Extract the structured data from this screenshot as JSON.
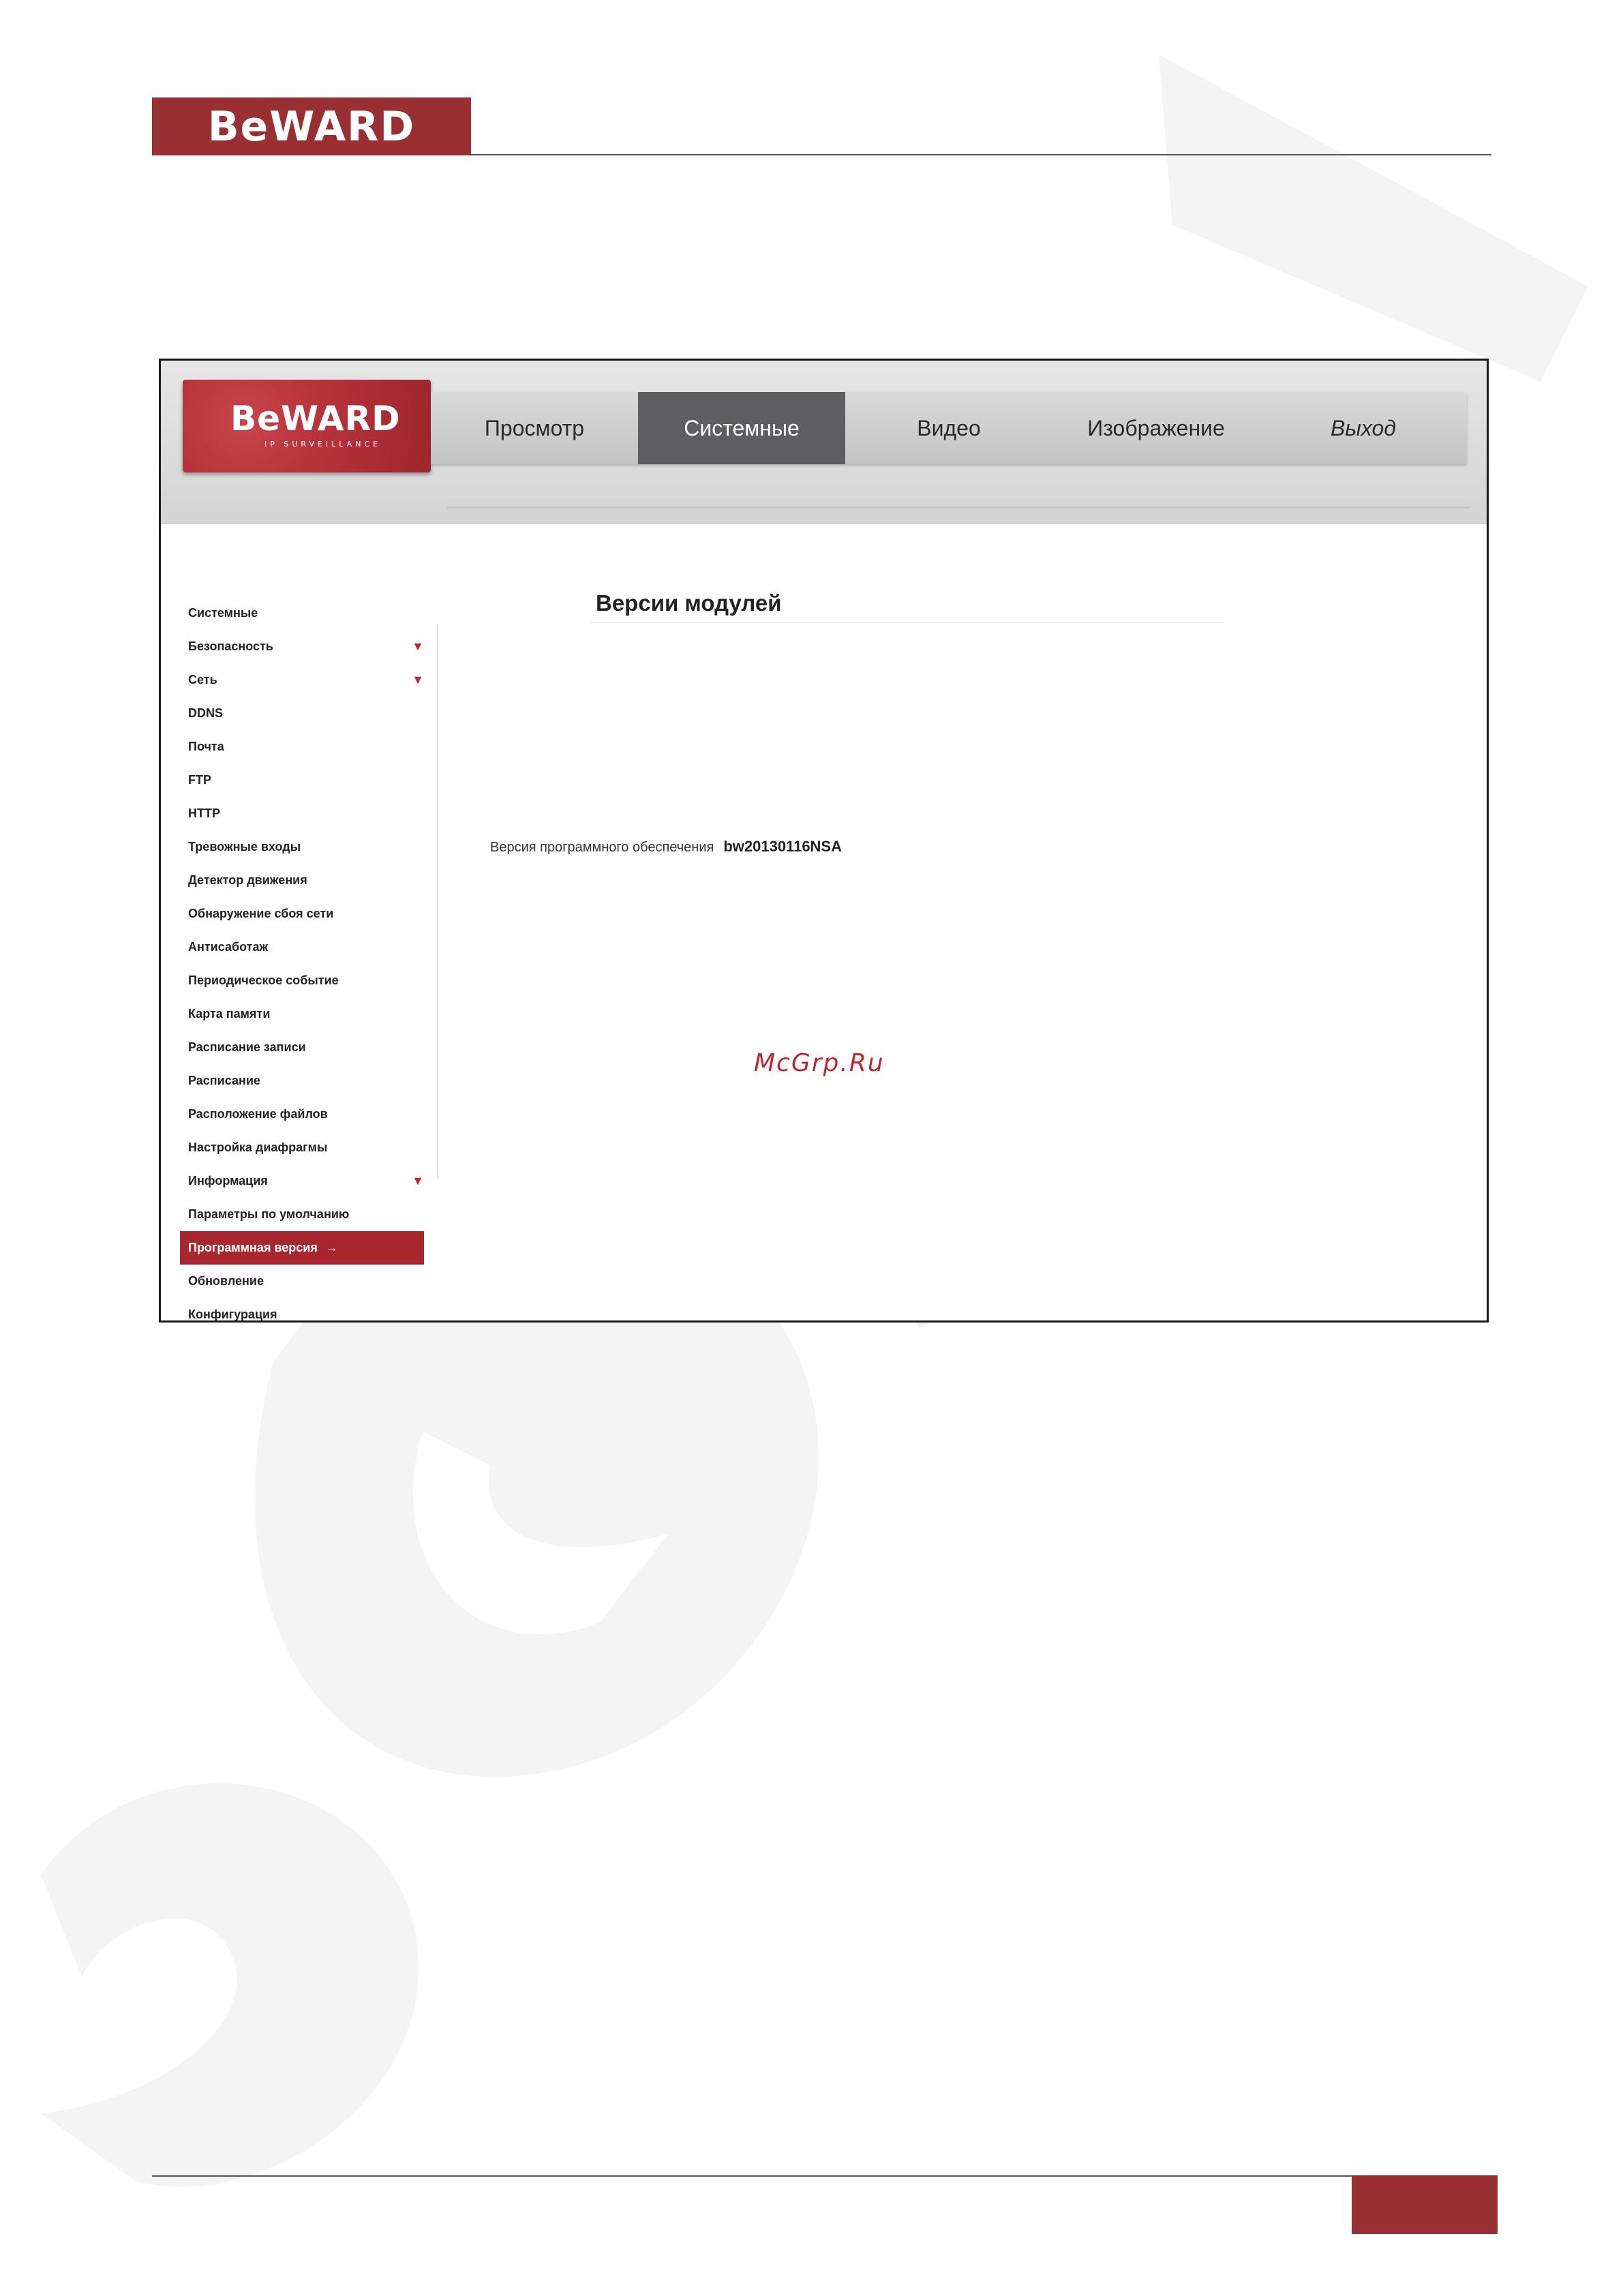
{
  "page": {
    "logo_text": "BeWARD"
  },
  "app": {
    "logo": {
      "brand": "BeWARD",
      "tagline": "IP SURVEILLANCE"
    },
    "nav": [
      {
        "label": "Просмотр",
        "active": false
      },
      {
        "label": "Системные",
        "active": true
      },
      {
        "label": "Видео",
        "active": false
      },
      {
        "label": "Изображение",
        "active": false
      },
      {
        "label": "Выход",
        "active": false
      }
    ],
    "sidebar": [
      {
        "label": "Системные"
      },
      {
        "label": "Безопасность",
        "expandable": true
      },
      {
        "label": "Сеть",
        "expandable": true
      },
      {
        "label": "DDNS"
      },
      {
        "label": "Почта"
      },
      {
        "label": "FTP"
      },
      {
        "label": "HTTP"
      },
      {
        "label": "Тревожные входы"
      },
      {
        "label": "Детектор движения"
      },
      {
        "label": "Обнаружение сбоя сети"
      },
      {
        "label": "Антисаботаж"
      },
      {
        "label": "Периодическое событие"
      },
      {
        "label": "Карта памяти"
      },
      {
        "label": "Расписание записи"
      },
      {
        "label": "Расписание"
      },
      {
        "label": "Расположение файлов"
      },
      {
        "label": "Настройка диафрагмы"
      },
      {
        "label": "Информация",
        "expandable": true
      },
      {
        "label": "Параметры по умолчанию"
      },
      {
        "label": "Программная версия",
        "active": true
      },
      {
        "label": "Обновление"
      },
      {
        "label": "Конфигурация"
      }
    ],
    "content": {
      "title": "Версии модулей",
      "firmware_label": "Версия программного обеспечения",
      "firmware_value": "bw20130116NSA"
    }
  },
  "watermark": {
    "site": "McGrp.Ru"
  },
  "colors": {
    "brand_red": "#9a2f33",
    "active_nav": "#5e5e60",
    "arrow_red": "#c0272d"
  },
  "icons": {
    "expand": "triangle-down-icon",
    "current": "arrow-right-icon"
  }
}
